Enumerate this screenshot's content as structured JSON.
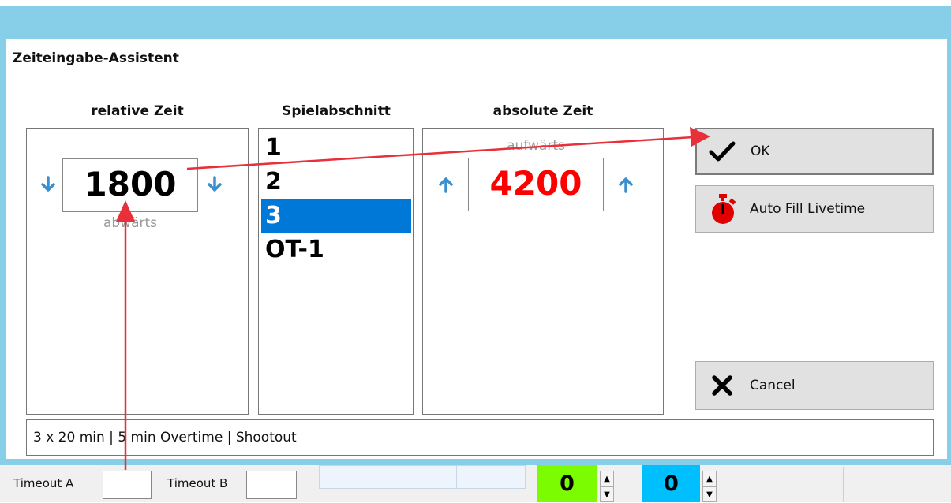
{
  "dialog": {
    "title": "Zeiteingabe-Assistent"
  },
  "relative": {
    "header": "relative Zeit",
    "value": "1800",
    "direction_label": "abwärts"
  },
  "period": {
    "header": "Spielabschnitt",
    "items": [
      "1",
      "2",
      "3",
      "OT-1"
    ],
    "selected_index": 2
  },
  "absolute": {
    "header": "absolute Zeit",
    "value": "4200",
    "direction_label": "aufwärts"
  },
  "buttons": {
    "ok": "OK",
    "autofill": "Auto Fill Livetime",
    "cancel": "Cancel"
  },
  "footer": {
    "info": "3 x 20 min | 5 min Overtime | Shootout"
  },
  "bottom": {
    "timeout_a": "Timeout A",
    "timeout_b": "Timeout B",
    "score_a": "0",
    "score_b": "0"
  },
  "colors": {
    "frame": "#87cfe9",
    "accent_blue": "#3a8fd0",
    "selection": "#0078d7",
    "absolute_value": "#ff0000",
    "annotation": "#e8303a",
    "score_a_bg": "#7cfc00",
    "score_b_bg": "#00bfff"
  }
}
